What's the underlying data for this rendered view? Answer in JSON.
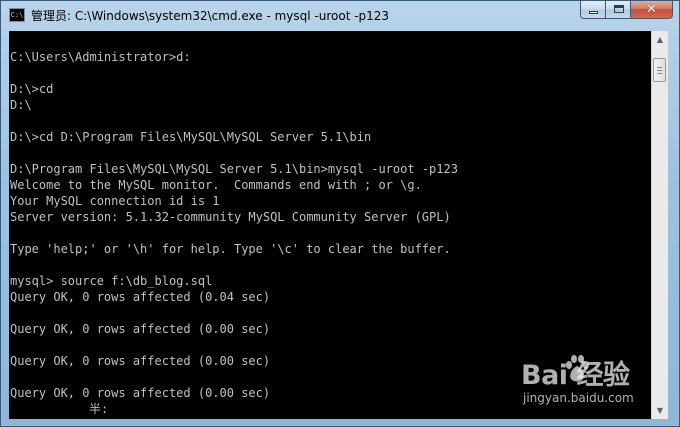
{
  "window": {
    "title": "管理员: C:\\Windows\\system32\\cmd.exe - mysql  -uroot -p123",
    "icon": "cmd-icon",
    "icon_text": "C:\\"
  },
  "caption_buttons": {
    "minimize_icon": "minimize-icon",
    "maximize_icon": "maximize-icon",
    "close_icon": "close-icon",
    "close_glyph": "✕"
  },
  "console": {
    "lines": [
      "",
      "C:\\Users\\Administrator>d:",
      "",
      "D:\\>cd",
      "D:\\",
      "",
      "D:\\>cd D:\\Program Files\\MySQL\\MySQL Server 5.1\\bin",
      "",
      "D:\\Program Files\\MySQL\\MySQL Server 5.1\\bin>mysql -uroot -p123",
      "Welcome to the MySQL monitor.  Commands end with ; or \\g.",
      "Your MySQL connection id is 1",
      "Server version: 5.1.32-community MySQL Community Server (GPL)",
      "",
      "Type 'help;' or '\\h' for help. Type '\\c' to clear the buffer.",
      "",
      "mysql> source f:\\db_blog.sql",
      "Query OK, 0 rows affected (0.04 sec)",
      "",
      "Query OK, 0 rows affected (0.00 sec)",
      "",
      "Query OK, 0 rows affected (0.00 sec)",
      "",
      "Query OK, 0 rows affected (0.00 sec)"
    ],
    "ime_indicator": "半:"
  },
  "scrollbar": {
    "up_arrow": "▲",
    "down_arrow": "▼",
    "position": 0.0
  },
  "watermark": {
    "brand": "Bai  经验",
    "url": "jingyan.baidu.com",
    "icon": "baidu-paw-icon"
  },
  "colors": {
    "console_background": "#000000",
    "console_text": "#c0c0c0",
    "titlebar": "#a9c8e4",
    "close_button": "#c8523c"
  }
}
